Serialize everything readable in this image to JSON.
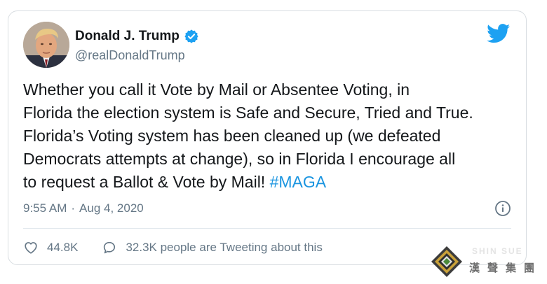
{
  "tweet": {
    "display_name": "Donald J. Trump",
    "handle": "@realDonaldTrump",
    "text": "Whether you call it Vote by Mail or Absentee Voting, in\nFlorida the election system is Safe and Secure, Tried and True.\nFlorida’s Voting system has been cleaned up (we defeated\nDemocrats attempts at change), so in Florida I encourage all\nto request a Ballot & Vote by Mail! ",
    "hashtag": "#MAGA",
    "time": "9:55 AM",
    "separator": "·",
    "date": "Aug 4, 2020",
    "likes": "44.8K",
    "retweet_discussion": "32.3K people are Tweeting about this"
  },
  "watermark": {
    "top_text": "SHIN SUE",
    "chinese_text": "漢聲集團"
  },
  "colors": {
    "link": "#1b95e0",
    "verified": "#1da1f2",
    "muted": "#657786",
    "border": "#d8dde1"
  },
  "icons": {
    "brand": "twitter-bird-icon",
    "verified": "verified-badge-icon",
    "info": "info-icon",
    "like": "heart-icon",
    "reply": "speech-bubble-icon"
  }
}
